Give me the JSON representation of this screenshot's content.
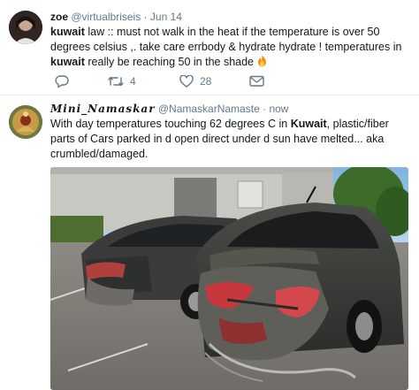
{
  "tweets": [
    {
      "display_name": "zoe",
      "handle": "@virtualbriseis",
      "separator": "·",
      "time": "Jun 14",
      "text_parts": [
        {
          "text": "kuwait",
          "bold": true
        },
        {
          "text": " law :: must not walk in the heat if the temperature is over 50 degrees celsius ,. take care errbody & hydrate hydrate ! temperatures in ",
          "bold": false
        },
        {
          "text": "kuwait",
          "bold": true
        },
        {
          "text": " really be reaching 50 in the shade ",
          "bold": false
        }
      ],
      "emoji": "fire-emoji",
      "actions": {
        "reply_count": "",
        "retweet_count": "4",
        "like_count": "28"
      },
      "icons": [
        "reply-icon",
        "retweet-icon",
        "heart-icon",
        "mail-icon"
      ]
    },
    {
      "display_name": "𝑴𝒊𝒏𝒊_𝑵𝒂𝒎𝒂𝒔𝒌𝒂𝒓",
      "handle": "@NamaskarNamaste",
      "separator": "·",
      "time": "now",
      "text_parts": [
        {
          "text": "With day temperatures touching 62 degrees C in ",
          "bold": false
        },
        {
          "text": "Kuwait",
          "bold": true
        },
        {
          "text": ", plastic/fiber parts of Cars parked in d open direct under d sun have melted... aka crumbled/damaged.",
          "bold": false
        }
      ],
      "photo": "photo of two cars in a parking lot with melted rear bumpers"
    }
  ],
  "colors": {
    "text": "#14171a",
    "secondary": "#657786",
    "divider": "#e6ecf0"
  }
}
